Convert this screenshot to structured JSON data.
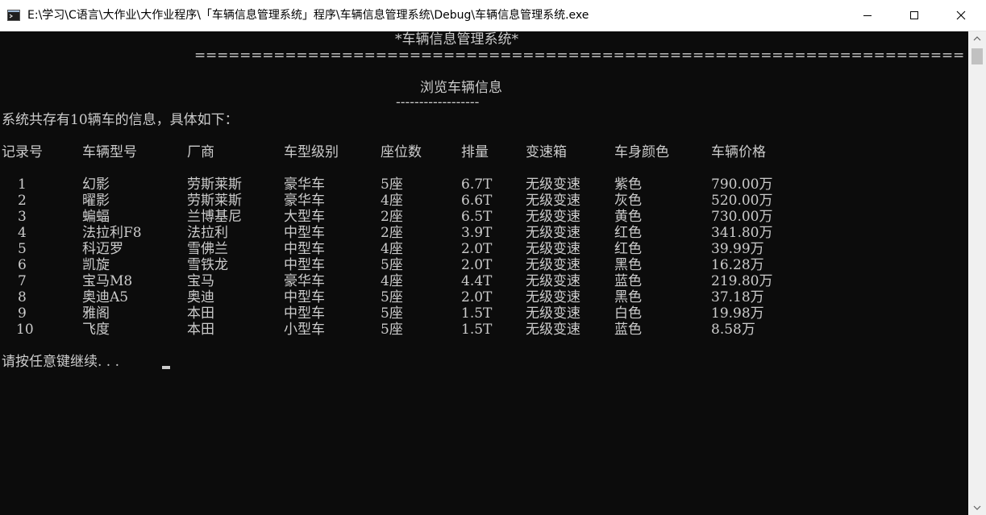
{
  "window": {
    "title": "E:\\学习\\C语言\\大作业\\大作业程序\\「车辆信息管理系统」程序\\车辆信息管理系统\\Debug\\车辆信息管理系统.exe"
  },
  "console": {
    "header_title": "*车辆信息管理系统*",
    "header_rule": "====================================================================",
    "section_title": "浏览车辆信息",
    "section_rule": "------------------",
    "summary": "系统共存有10辆车的信息，具体如下：",
    "columns": [
      "记录号",
      "车辆型号",
      "厂商",
      "车型级别",
      "座位数",
      "排量",
      "变速箱",
      "车身颜色",
      "车辆价格"
    ],
    "rows": [
      [
        "1",
        "幻影",
        "劳斯莱斯",
        "豪华车",
        "5座",
        "6.7T",
        "无级变速",
        "紫色",
        "790.00万"
      ],
      [
        "2",
        "曜影",
        "劳斯莱斯",
        "豪华车",
        "4座",
        "6.6T",
        "无级变速",
        "灰色",
        "520.00万"
      ],
      [
        "3",
        "蝙蝠",
        "兰博基尼",
        "大型车",
        "2座",
        "6.5T",
        "无级变速",
        "黄色",
        "730.00万"
      ],
      [
        "4",
        "法拉利F8",
        "法拉利",
        "中型车",
        "2座",
        "3.9T",
        "无级变速",
        "红色",
        "341.80万"
      ],
      [
        "5",
        "科迈罗",
        "雪佛兰",
        "中型车",
        "4座",
        "2.0T",
        "无级变速",
        "红色",
        "39.99万"
      ],
      [
        "6",
        "凯旋",
        "雪铁龙",
        "中型车",
        "5座",
        "2.0T",
        "无级变速",
        "黑色",
        "16.28万"
      ],
      [
        "7",
        "宝马M8",
        "宝马",
        "豪华车",
        "4座",
        "4.4T",
        "无级变速",
        "蓝色",
        "219.80万"
      ],
      [
        "8",
        "奥迪A5",
        "奥迪",
        "中型车",
        "5座",
        "2.0T",
        "无级变速",
        "黑色",
        "37.18万"
      ],
      [
        "9",
        "雅阁",
        "本田",
        "中型车",
        "5座",
        "1.5T",
        "无级变速",
        "白色",
        "19.98万"
      ],
      [
        "10",
        "飞度",
        "本田",
        "小型车",
        "5座",
        "1.5T",
        "无级变速",
        "蓝色",
        "8.58万"
      ]
    ],
    "prompt": "请按任意键继续. . ."
  }
}
